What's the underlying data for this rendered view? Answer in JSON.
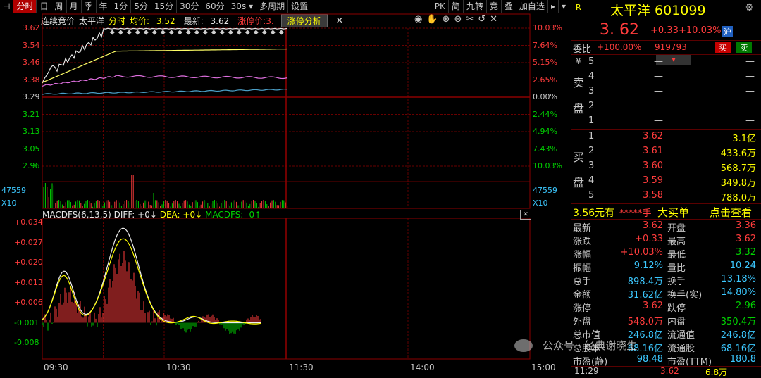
{
  "toolbar": {
    "items": [
      "分时",
      "日",
      "周",
      "月",
      "季",
      "年",
      "1分",
      "5分",
      "15分",
      "30分",
      "60分",
      "30s",
      "多周期",
      "设置"
    ],
    "right_items": [
      "PK",
      "简",
      "九转",
      "竞",
      "叠",
      "加自选"
    ]
  },
  "info": {
    "mode": "连续竞价",
    "name": "太平洋",
    "tab": "分时",
    "avg_label": "均价:",
    "avg_value": "3.52",
    "latest_label": "最新:",
    "latest_value": "3.62",
    "limit_label": "涨停价:3.",
    "analysis_btn": "涨停分析"
  },
  "price_axis": {
    "left": [
      "3.62",
      "3.54",
      "3.46",
      "3.38",
      "3.29",
      "3.21",
      "3.13",
      "3.05",
      "2.96"
    ],
    "right": [
      "10.03%",
      "7.64%",
      "5.15%",
      "2.65%",
      "0.00%",
      "2.44%",
      "4.94%",
      "7.43%",
      "10.03%"
    ]
  },
  "volume_axis": {
    "max": "47559",
    "unit": "X10"
  },
  "macd": {
    "label": "MACDFS(6,13,5)",
    "diff": "DIFF: +0↓",
    "dea": "DEA: +0↓",
    "macdfs": "MACDFS: -0↑",
    "axis": [
      "+0.034",
      "+0.027",
      "+0.020",
      "+0.013",
      "+0.006",
      "-0.001",
      "-0.008"
    ]
  },
  "time_axis": [
    "09:30",
    "10:30",
    "11:30",
    "14:00",
    "15:00"
  ],
  "quote": {
    "badge": "R",
    "title": "太平洋 601099",
    "price": "3. 62",
    "change": "+0.33",
    "change_pct": "+10.03%",
    "exchange": "沪",
    "weibi_label": "委比",
    "weibi_value": "+100.00%",
    "weibi_volume": "919793",
    "buy_btn": "买",
    "sell_btn": "卖",
    "yen": "¥",
    "sell_label": [
      "卖",
      "盘"
    ],
    "buy_label": [
      "买",
      "盘"
    ],
    "sell_levels": [
      {
        "n": "5",
        "p": "—",
        "v": "—"
      },
      {
        "n": "4",
        "p": "—",
        "v": "—"
      },
      {
        "n": "3",
        "p": "—",
        "v": "—"
      },
      {
        "n": "2",
        "p": "—",
        "v": "—"
      },
      {
        "n": "1",
        "p": "—",
        "v": "—"
      }
    ],
    "buy_levels": [
      {
        "n": "1",
        "p": "3.62",
        "v": "3.1亿"
      },
      {
        "n": "2",
        "p": "3.61",
        "v": "433.6万"
      },
      {
        "n": "3",
        "p": "3.60",
        "v": "568.7万"
      },
      {
        "n": "4",
        "p": "3.59",
        "v": "349.8万"
      },
      {
        "n": "5",
        "p": "3.58",
        "v": "788.0万"
      }
    ],
    "banner_left": "3.56元有",
    "banner_mid": "*****手",
    "banner_big": "大买单",
    "banner_right": "点击查看",
    "stats": [
      {
        "l1": "最新",
        "v1": "3.62",
        "l2": "开盘",
        "v2": "3.36"
      },
      {
        "l1": "涨跌",
        "v1": "+0.33",
        "l2": "最高",
        "v2": "3.62"
      },
      {
        "l1": "涨幅",
        "v1": "+10.03%",
        "l2": "最低",
        "v2": "3.32"
      },
      {
        "l1": "振幅",
        "v1": "9.12%",
        "l2": "量比",
        "v2": "10.24"
      },
      {
        "l1": "总手",
        "v1": "898.4万",
        "l2": "换手",
        "v2": "13.18%"
      },
      {
        "l1": "金额",
        "v1": "31.62亿",
        "l2": "换手(实)",
        "v2": "14.80%"
      },
      {
        "l1": "涨停",
        "v1": "3.62",
        "l2": "跌停",
        "v2": "2.96"
      },
      {
        "l1": "外盘",
        "v1": "548.0万",
        "l2": "内盘",
        "v2": "350.4万"
      },
      {
        "l1": "总市值",
        "v1": "246.8亿",
        "l2": "流通值",
        "v2": "246.8亿"
      },
      {
        "l1": "总股本",
        "v1": "68.16亿",
        "l2": "流通股",
        "v2": "68.16亿"
      },
      {
        "l1": "市盈(静)",
        "v1": "98.48",
        "l2": "市盈(TTM)",
        "v2": "180.8"
      }
    ],
    "last_trade": {
      "time": "11:29",
      "price": "3.62",
      "vol": "6.8万"
    }
  },
  "watermark": "公众号 · 经典谢晓生",
  "colors": {
    "up": "#ff3c3c",
    "down": "#00d200",
    "grid": "#8b0000",
    "price_line": "#e6e6e6",
    "avg_line": "#ffff00"
  }
}
